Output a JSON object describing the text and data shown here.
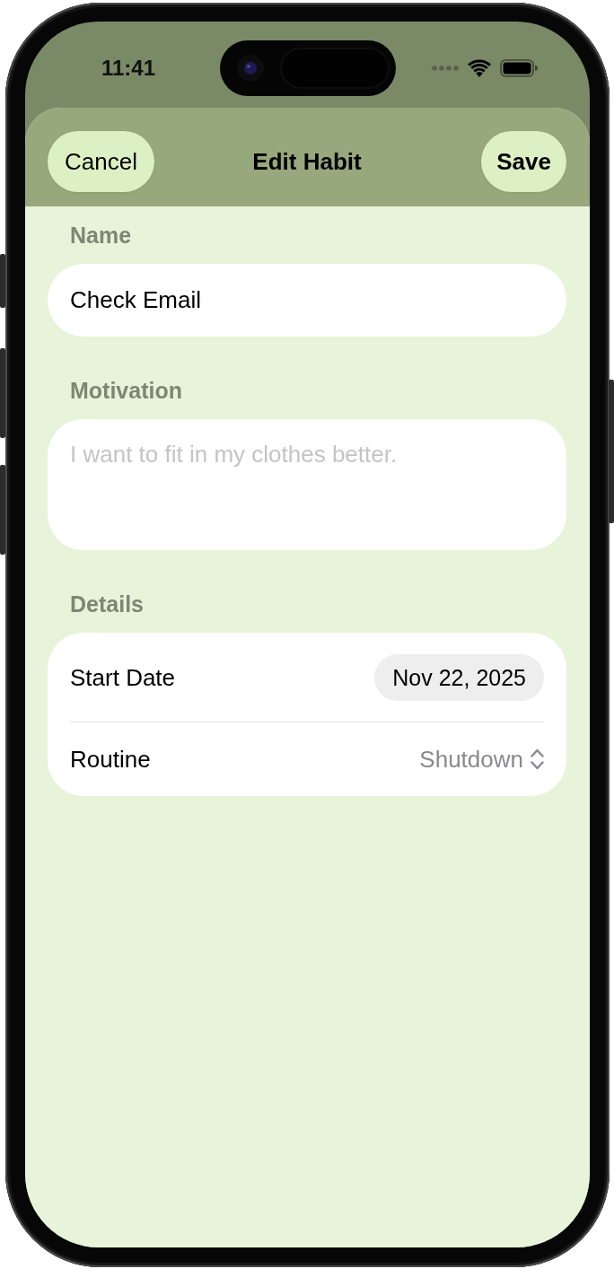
{
  "status_bar": {
    "time": "11:41"
  },
  "nav": {
    "cancel": "Cancel",
    "title": "Edit Habit",
    "save": "Save"
  },
  "sections": [
    {
      "kind": "text",
      "label": "Name",
      "value": "Check Email"
    },
    {
      "kind": "textarea",
      "label": "Motivation",
      "placeholder": "I want to fit in my clothes better."
    },
    {
      "kind": "rows",
      "label": "Details",
      "rows": [
        {
          "kind": "date",
          "label": "Start Date",
          "value": "Nov 22, 2025"
        },
        {
          "kind": "picker",
          "label": "Routine",
          "value": "Shutdown"
        }
      ]
    }
  ]
}
